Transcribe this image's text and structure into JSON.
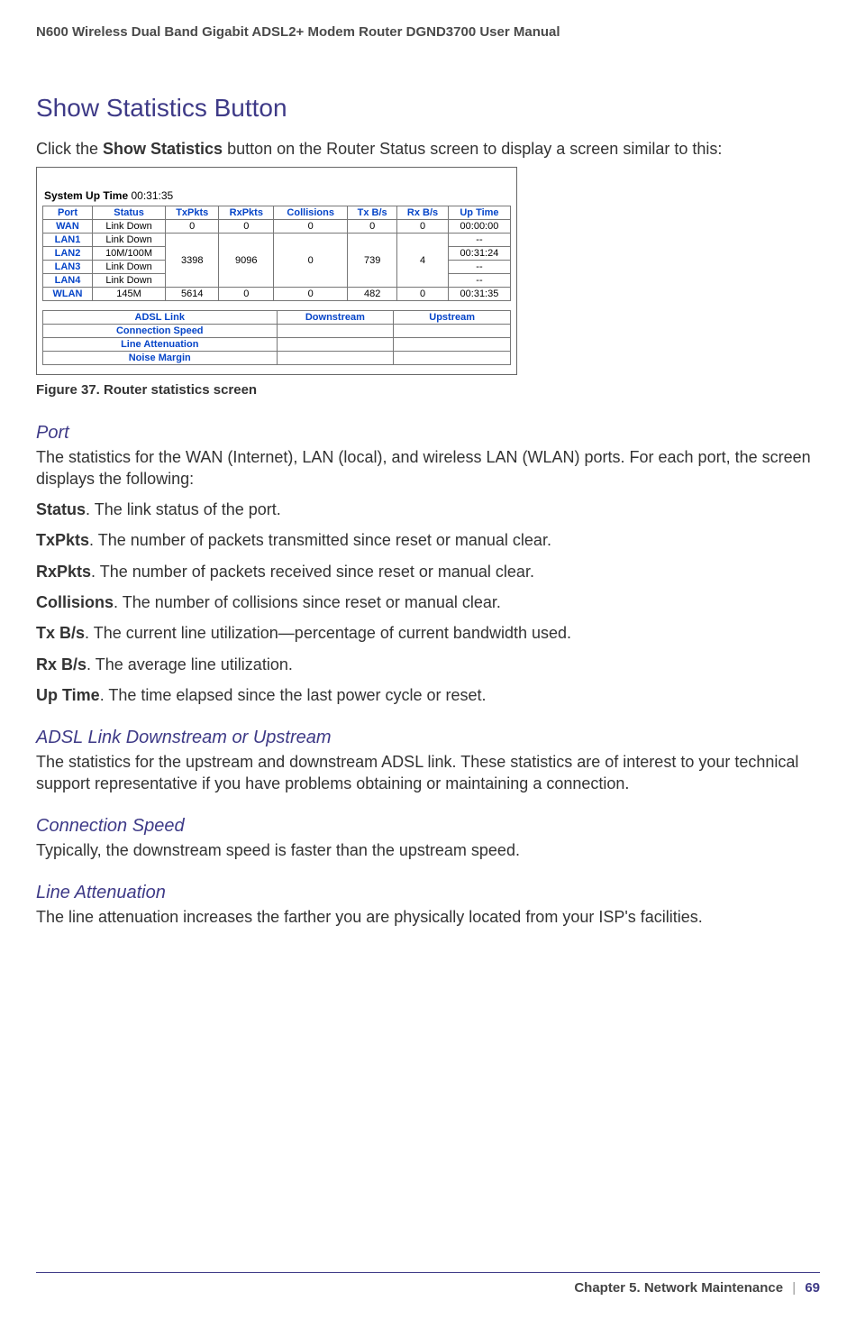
{
  "header": {
    "title": "N600 Wireless Dual Band Gigabit ADSL2+ Modem Router DGND3700 User Manual"
  },
  "h1": "Show Statistics Button",
  "intro": {
    "pre": "Click the ",
    "bold": "Show Statistics",
    "post": " button on the Router Status screen to display a screen similar to this:"
  },
  "screenshot": {
    "sys_label": "System Up Time",
    "sys_value": "00:31:35",
    "columns": [
      "Port",
      "Status",
      "TxPkts",
      "RxPkts",
      "Collisions",
      "Tx B/s",
      "Rx B/s",
      "Up Time"
    ],
    "rows": [
      {
        "port": "WAN",
        "status": "Link Down",
        "tx": "0",
        "rx": "0",
        "col": "0",
        "txbs": "0",
        "rxbs": "0",
        "up": "00:00:00"
      },
      {
        "port": "LAN1",
        "status": "Link Down",
        "tx": "",
        "rx": "",
        "col": "",
        "txbs": "",
        "rxbs": "",
        "up": "--"
      },
      {
        "port": "LAN2",
        "status": "10M/100M",
        "tx": "3398",
        "rx": "9096",
        "col": "0",
        "txbs": "739",
        "rxbs": "4",
        "up": "00:31:24"
      },
      {
        "port": "LAN3",
        "status": "Link Down",
        "tx": "",
        "rx": "",
        "col": "",
        "txbs": "",
        "rxbs": "",
        "up": "--"
      },
      {
        "port": "LAN4",
        "status": "Link Down",
        "tx": "",
        "rx": "",
        "col": "",
        "txbs": "",
        "rxbs": "",
        "up": "--"
      },
      {
        "port": "WLAN",
        "status": "145M",
        "tx": "5614",
        "rx": "0",
        "col": "0",
        "txbs": "482",
        "rxbs": "0",
        "up": "00:31:35"
      }
    ],
    "adsl_headers": [
      "ADSL Link",
      "Downstream",
      "Upstream"
    ],
    "adsl_rows": [
      "Connection Speed",
      "Line Attenuation",
      "Noise Margin"
    ]
  },
  "figure_caption": "Figure 37. Router statistics screen",
  "sections": {
    "port": {
      "title": "Port",
      "intro": "The statistics for the WAN (Internet), LAN (local), and wireless LAN (WLAN) ports. For each port, the screen displays the following:",
      "defs": [
        {
          "b": "Status",
          "t": ". The link status of the port."
        },
        {
          "b": "TxPkts",
          "t": ". The number of packets transmitted since reset or manual clear."
        },
        {
          "b": "RxPkts",
          "t": ". The number of packets received since reset or manual clear."
        },
        {
          "b": "Collisions",
          "t": ". The number of collisions since reset or manual clear."
        },
        {
          "b": "Tx B/s",
          "t": ". The current line utilization—percentage of current bandwidth used."
        },
        {
          "b": "Rx B/s",
          "t": ". The average line utilization."
        },
        {
          "b": "Up Time",
          "t": ". The time elapsed since the last power cycle or reset."
        }
      ]
    },
    "adsl": {
      "title": "ADSL Link Downstream or Upstream",
      "text": "The statistics for the upstream and downstream ADSL link. These statistics are of interest to your technical support representative if you have problems obtaining or maintaining a connection."
    },
    "conn": {
      "title": "Connection Speed",
      "text": "Typically, the downstream speed is faster than the upstream speed."
    },
    "line": {
      "title": "Line Attenuation",
      "text": "The line attenuation increases the farther you are physically located from your ISP's facilities."
    }
  },
  "footer": {
    "chapter": "Chapter 5.  Network Maintenance",
    "sep": "|",
    "page": "69"
  }
}
